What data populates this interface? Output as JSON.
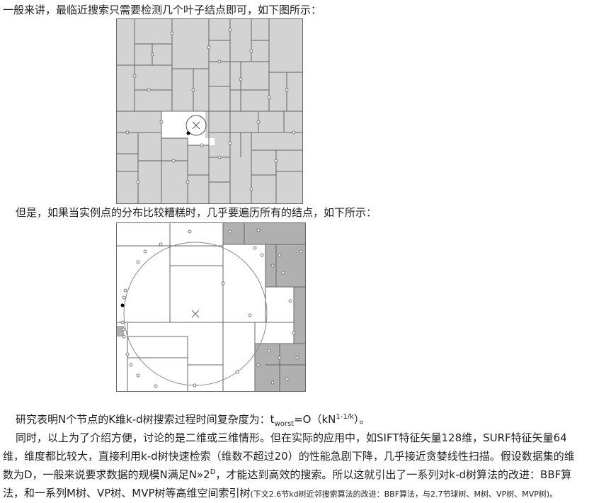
{
  "intro_line": "一般来讲，最临近搜索只需要检测几个叶子结点即可，如下图所示：",
  "but_line": "但是，如果当实例点的分布比较糟糕时，几乎要遍历所有的结点，如下所示：",
  "complexity": {
    "pre": "研究表明N个节点的K维k-d树搜索过程时间复杂度为：t",
    "sub": "worst",
    "mid": "=O（kN",
    "sup": "1-1/k",
    "post": "）。"
  },
  "para_l1": "同时，以上为了介绍方便，讨论的是二维或三维情形。但在实际的应用中，如SIFT特征矢量128维，SURF特征矢量64",
  "para_l2": "维，维度都比较大，直接利用k-d树快速检索（维数不超过20）的性能急剧下降，几乎接近贪婪线性扫描。假设数据集的维",
  "para_l3": {
    "pre": "数为D，一般来说要求数据的规模N满足N»2",
    "sup": "D",
    "post": "，才能达到高效的搜索。所以这就引出了一系列对k-d树算法的改进：BBF算"
  },
  "para_l4": {
    "main": "法，和一系列M树、VP树、MVP树等高维空间索引树",
    "note": "(下文2.6节kd树近邻搜索算法的改进：BBF算法，与2.7节球树、M树、VP树、MVP树)。"
  }
}
